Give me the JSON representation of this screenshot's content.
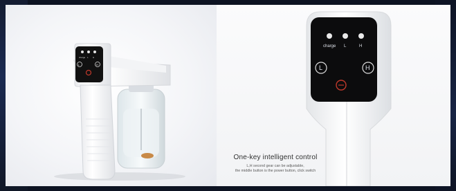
{
  "left_device": {
    "indicator_labels": [
      "charge",
      "L",
      "H"
    ],
    "button_labels": [
      "L",
      "H"
    ]
  },
  "right_closeup": {
    "indicator_labels": [
      "charge",
      "L",
      "H"
    ],
    "button_labels": [
      "L",
      "H"
    ]
  },
  "caption": {
    "title": "One-key intelligent control",
    "line1": "L,H second gear can be adjustable,",
    "line2": "the middle button is the power button, click switch"
  },
  "colors": {
    "device_body": "#f7f7f7",
    "panel_screen": "#111111",
    "power_button": "#c0392b",
    "background_edge": "#0d1322"
  }
}
